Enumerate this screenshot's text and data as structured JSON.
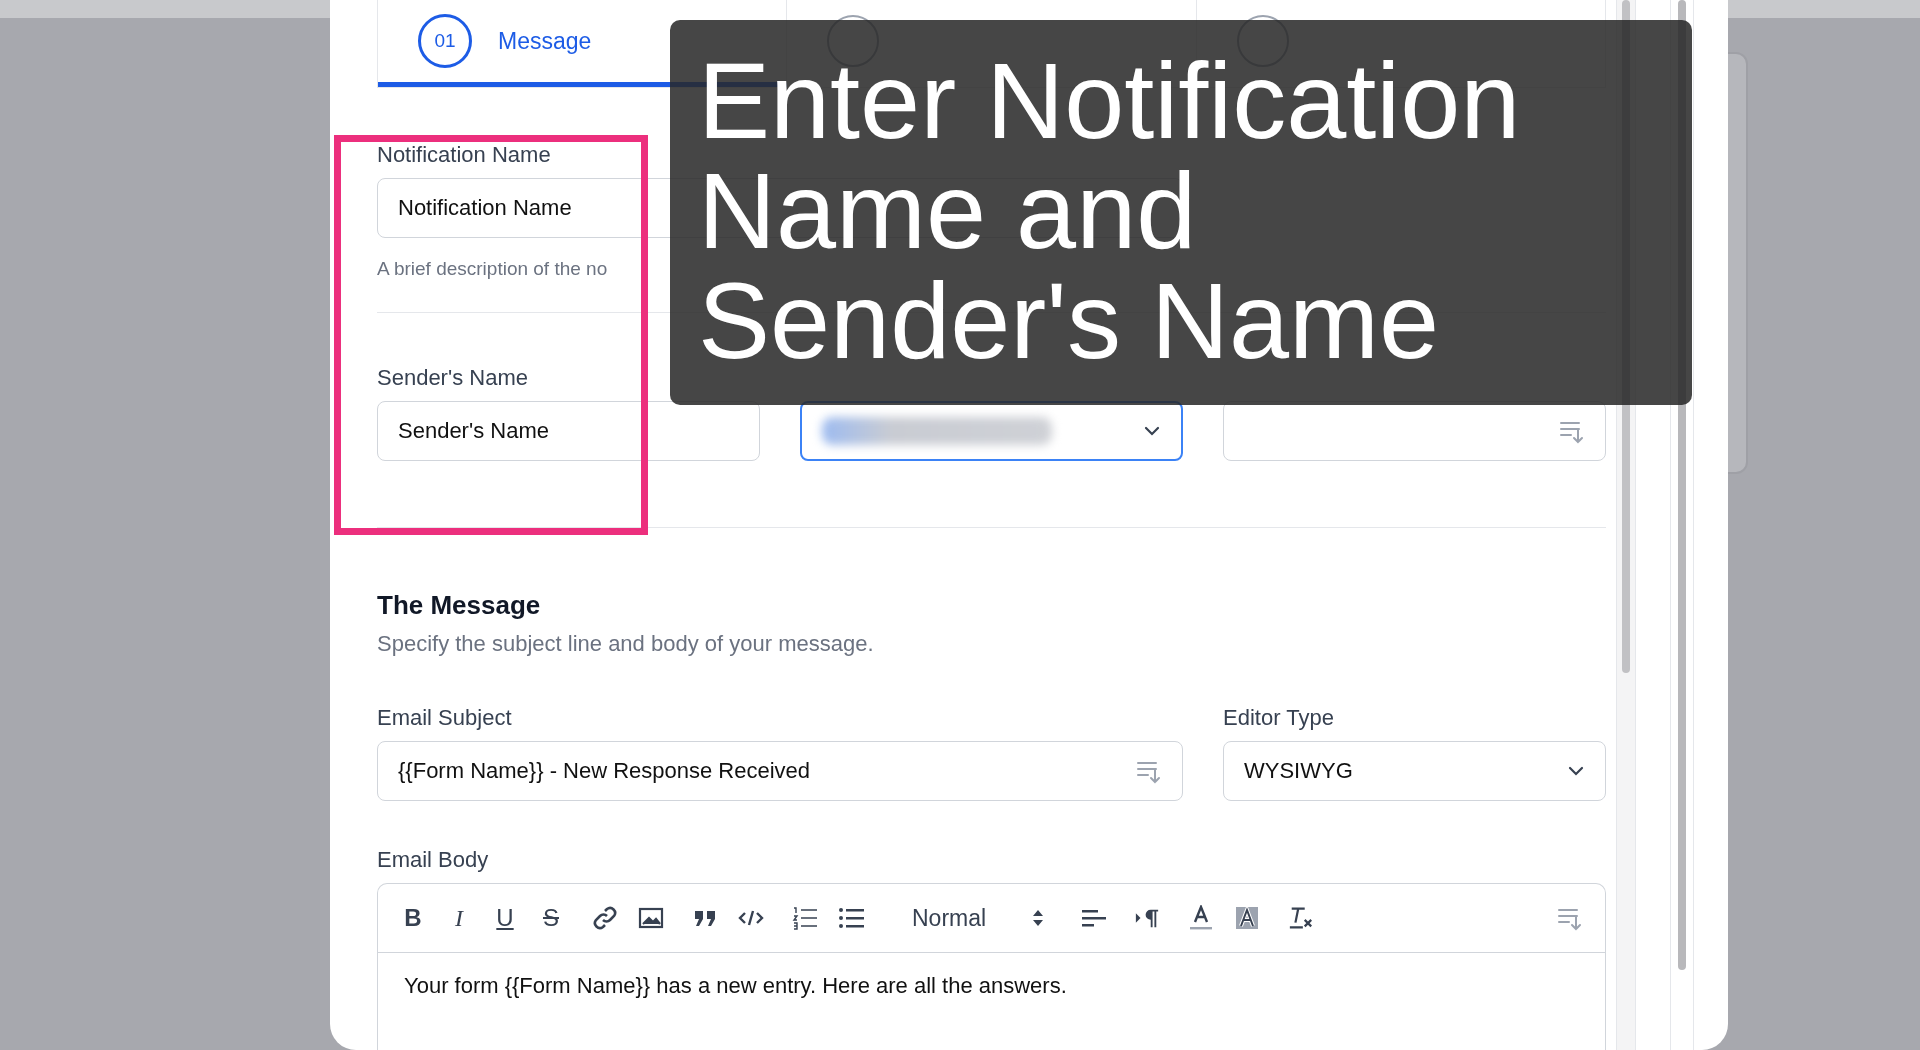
{
  "tabs": [
    {
      "number": "01",
      "label": "Message",
      "selected": true
    },
    {
      "selected": false
    },
    {
      "selected": false
    }
  ],
  "notification_name": {
    "label": "Notification Name",
    "value": "Notification Name",
    "hint": "A brief description of the no"
  },
  "sender_fields": [
    {
      "label": "Sender's Name",
      "kind": "text",
      "value": "Sender's Name",
      "focused": false
    },
    {
      "kind": "select",
      "focused": true
    },
    {
      "kind": "merge",
      "focused": false
    }
  ],
  "message_section": {
    "title": "The Message",
    "subtitle": "Specify the subject line and body of your message."
  },
  "email_subject": {
    "label": "Email Subject",
    "value": "{{Form Name}} - New Response Received"
  },
  "editor_type": {
    "label": "Editor Type",
    "value": "WYSIWYG"
  },
  "email_body": {
    "label": "Email Body",
    "toolbar": [
      [
        {
          "kind": "bold",
          "label": "B"
        },
        {
          "kind": "italic",
          "label": "I"
        },
        {
          "kind": "underline",
          "label": "U"
        },
        {
          "kind": "strike",
          "label": "S"
        }
      ],
      [
        {
          "kind": "link"
        },
        {
          "kind": "image"
        }
      ],
      [
        {
          "kind": "quote"
        },
        {
          "kind": "code"
        }
      ],
      [
        {
          "kind": "ordered-list"
        },
        {
          "kind": "bullet-list"
        }
      ],
      [
        {
          "kind": "header-select",
          "label": "Normal"
        }
      ],
      [
        {
          "kind": "align"
        }
      ],
      [
        {
          "kind": "direction"
        }
      ],
      [
        {
          "kind": "text-color"
        },
        {
          "kind": "background-color"
        }
      ],
      [
        {
          "kind": "clear-format"
        }
      ]
    ],
    "text": "Your form {{Form Name}} has a new entry. Here are all the answers."
  },
  "caption": {
    "lines": [
      "Enter Notification",
      "Name and",
      "Sender's Name"
    ]
  }
}
